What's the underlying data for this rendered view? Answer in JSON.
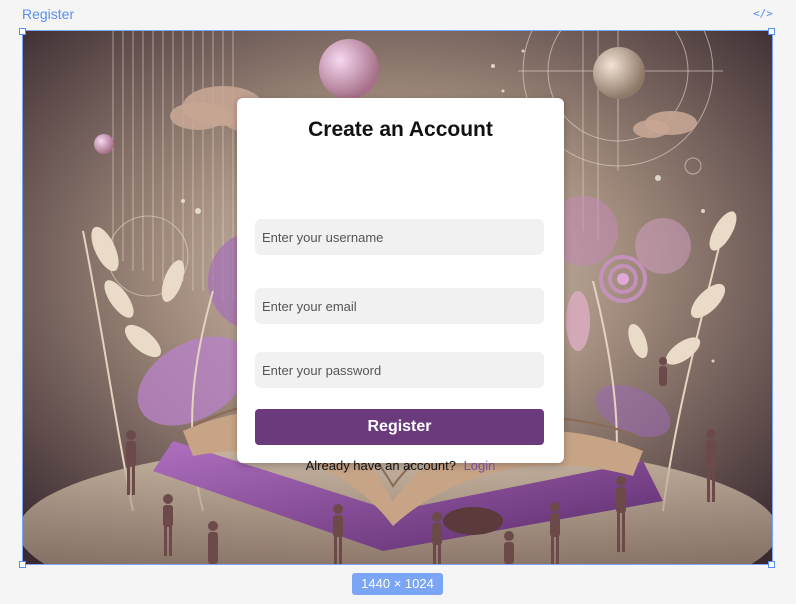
{
  "design_tool": {
    "frame_name": "Register",
    "code_icon": "code-icon",
    "dimensions_badge": "1440 × 1024"
  },
  "register": {
    "title": "Create an Account",
    "username_placeholder": "Enter your username",
    "email_placeholder": "Enter your email",
    "password_placeholder": "Enter your password",
    "submit_label": "Register",
    "login_prompt": "Already have an account?",
    "login_link": "Login"
  },
  "colors": {
    "accent": "#6b3a7c",
    "link": "#7a4ea0",
    "selection": "#5b8ff0"
  }
}
